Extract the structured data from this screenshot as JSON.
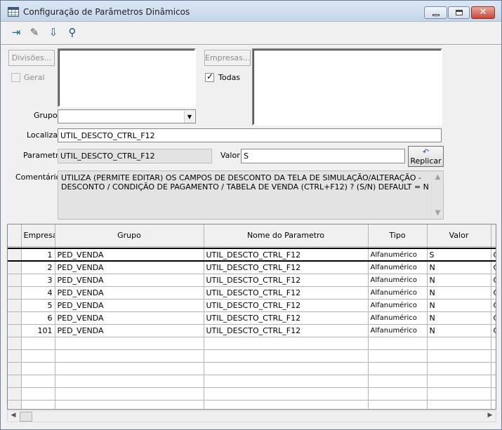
{
  "window": {
    "title": "Configuração de Parâmetros Dinâmicos",
    "icon": "table-icon"
  },
  "toolbar": {
    "items": [
      {
        "name": "exit-door-icon",
        "glyph": "⇥"
      },
      {
        "name": "pencil-icon",
        "glyph": "✎"
      },
      {
        "name": "download-tray-icon",
        "glyph": "⇩"
      },
      {
        "name": "binoculars-icon",
        "glyph": "⚲"
      }
    ]
  },
  "filters": {
    "divisoes_label": "Divisões...",
    "empresas_label": "Empresas...",
    "geral_label": "Geral",
    "geral_checked": false,
    "todas_label": "Todas",
    "todas_checked": true,
    "grupo_label": "Grupo",
    "grupo_value": "",
    "localizar_label": "Localizar",
    "localizar_value": "UTIL_DESCTO_CTRL_F12"
  },
  "detail": {
    "parametro_label": "Parametro",
    "parametro_value": "UTIL_DESCTO_CTRL_F12",
    "valor_label": "Valor",
    "valor_value": "S",
    "replicar_label": "Replicar",
    "comentarios_label": "Comentários",
    "comentarios_value": "UTILIZA (PERMITE EDITAR) OS CAMPOS DE DESCONTO DA TELA DE SIMULAÇÃO/ALTERAÇÃO - DESCONTO / CONDIÇÃO DE PAGAMENTO / TABELA DE VENDA  (CTRL+F12) ? (S/N) DEFAULT = N"
  },
  "grid": {
    "columns": [
      "Empresa",
      "Grupo",
      "Nome do Parametro",
      "Tipo",
      "Valor"
    ],
    "rows": [
      {
        "empresa": "1",
        "grupo": "PED_VENDA",
        "nome": "UTIL_DESCTO_CTRL_F12",
        "tipo": "Alfanumérico",
        "valor": "S",
        "extra": "C"
      },
      {
        "empresa": "2",
        "grupo": "PED_VENDA",
        "nome": "UTIL_DESCTO_CTRL_F12",
        "tipo": "Alfanumérico",
        "valor": "N",
        "extra": "C"
      },
      {
        "empresa": "3",
        "grupo": "PED_VENDA",
        "nome": "UTIL_DESCTO_CTRL_F12",
        "tipo": "Alfanumérico",
        "valor": "N",
        "extra": "C"
      },
      {
        "empresa": "4",
        "grupo": "PED_VENDA",
        "nome": "UTIL_DESCTO_CTRL_F12",
        "tipo": "Alfanumérico",
        "valor": "N",
        "extra": "C"
      },
      {
        "empresa": "5",
        "grupo": "PED_VENDA",
        "nome": "UTIL_DESCTO_CTRL_F12",
        "tipo": "Alfanumérico",
        "valor": "N",
        "extra": "C"
      },
      {
        "empresa": "6",
        "grupo": "PED_VENDA",
        "nome": "UTIL_DESCTO_CTRL_F12",
        "tipo": "Alfanumérico",
        "valor": "N",
        "extra": "C"
      },
      {
        "empresa": "101",
        "grupo": "PED_VENDA",
        "nome": "UTIL_DESCTO_CTRL_F12",
        "tipo": "Alfanumérico",
        "valor": "N",
        "extra": "C"
      }
    ],
    "empty_rows": 6
  }
}
